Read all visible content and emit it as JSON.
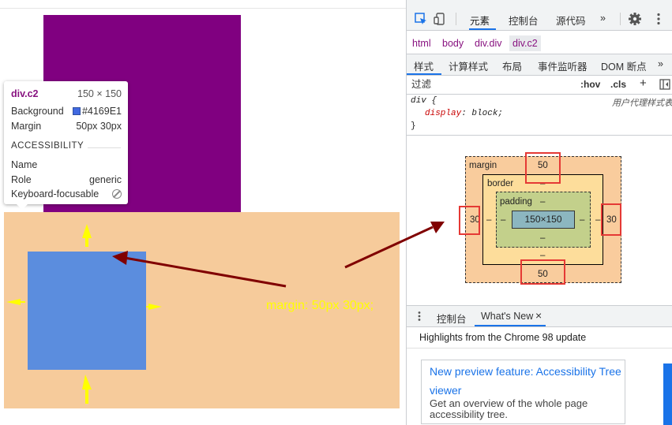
{
  "page": {
    "annotation": "margin:  50px 30px;",
    "colors": {
      "purple": "#800080",
      "margin_fill": "#f6cb9b",
      "box_blue": "#5b8dde",
      "arrow_dark_red": "#800000",
      "arrow_yellow": "#ffff00"
    }
  },
  "tooltip": {
    "tag": "div.c2",
    "size": "150 × 150",
    "background_label": "Background",
    "background_value": "#4169E1",
    "margin_label": "Margin",
    "margin_value": "50px 30px",
    "accessibility_heading": "ACCESSIBILITY",
    "name_label": "Name",
    "role_label": "Role",
    "role_value": "generic",
    "keyboard_label": "Keyboard-focusable",
    "keyboard_icon": "blocked-icon"
  },
  "devtools": {
    "toolbar": {
      "inspect_icon": "inspect-cursor-icon",
      "device_icon": "device-toggle-icon",
      "tabs": [
        "元素",
        "控制台",
        "源代码"
      ],
      "more": "»",
      "settings_icon": "gear-icon",
      "menu_icon": "kebab-menu-icon"
    },
    "breadcrumb": [
      "html",
      "body",
      "div.div",
      "div.c2"
    ],
    "subtabs": [
      "样式",
      "计算样式",
      "布局",
      "事件监听器",
      "DOM 断点",
      "»"
    ],
    "filter": {
      "placeholder": "过滤",
      "hov": ":hov",
      "cls": ".cls",
      "add": "+"
    },
    "rule": {
      "selector": "div {",
      "origin": "用户代理样式表",
      "property": "display",
      "value": "block;",
      "close": "}"
    },
    "box_model": {
      "margin_label": "margin",
      "border_label": "border",
      "padding_label": "padding",
      "margin_top": "50",
      "margin_bottom": "50",
      "margin_left": "30",
      "margin_right": "30",
      "border_top": "–",
      "border_bottom": "–",
      "border_left": "–",
      "border_right": "–",
      "padding_top": "–",
      "padding_bottom": "–",
      "padding_left": "–",
      "padding_right": "–",
      "content": "150×150"
    },
    "drawer": {
      "menu_icon": "kebab-menu-icon",
      "tabs": [
        "控制台",
        "What's New"
      ],
      "close": "×",
      "highlights": "Highlights from the Chrome 98 update",
      "card_title": "New preview feature: Accessibility Tree viewer",
      "card_desc": "Get an overview of the whole page accessibility tree."
    }
  }
}
